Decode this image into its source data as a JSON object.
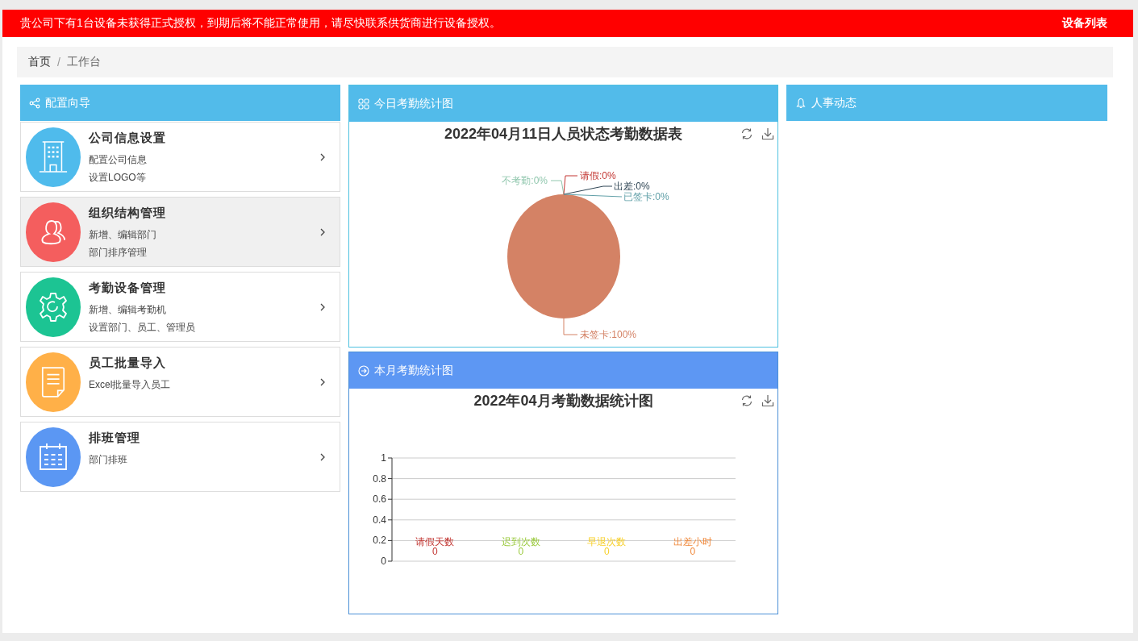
{
  "notice_bar": {
    "message": "贵公司下有1台设备未获得正式授权，到期后将不能正常使用，请尽快联系供货商进行设备授权。",
    "link": "设备列表"
  },
  "breadcrumb": {
    "separator": "/",
    "items": [
      {
        "label": "首页"
      },
      {
        "label": "工作台"
      }
    ]
  },
  "config_guide": {
    "title": "配置向导",
    "items": [
      {
        "kind": "building",
        "title": "公司信息设置",
        "lines": [
          "配置公司信息",
          "设置LOGO等"
        ],
        "color": "#4fbbec",
        "selected": false
      },
      {
        "kind": "people",
        "title": "组织结构管理",
        "lines": [
          "新增、编辑部门",
          "部门排序管理"
        ],
        "color": "#f45e5e",
        "selected": true
      },
      {
        "kind": "gear",
        "title": "考勤设备管理",
        "lines": [
          "新增、编辑考勤机",
          "设置部门、员工、管理员"
        ],
        "color": "#1cc493",
        "selected": false
      },
      {
        "kind": "document",
        "title": "员工批量导入",
        "lines": [
          "Excel批量导入员工"
        ],
        "color": "#ffb048",
        "selected": false
      },
      {
        "kind": "calendar",
        "title": "排班管理",
        "lines": [
          "部门排班"
        ],
        "color": "#5b97f3",
        "selected": false
      }
    ]
  },
  "today_panel": {
    "title": "今日考勤统计图",
    "chart_data": {
      "type": "pie",
      "title": "2022年04月11日人员状态考勤数据表",
      "categories": [
        "不考勤",
        "请假",
        "出差",
        "已签卡",
        "未签卡"
      ],
      "values": [
        0,
        0,
        0,
        0,
        100
      ],
      "value_labels": [
        ":0%",
        ":0%",
        ":0%",
        ":0%",
        ":100%"
      ],
      "colors": [
        "#91c7ae",
        "#c23531",
        "#2f4554",
        "#61a0a8",
        "#d48265"
      ]
    }
  },
  "month_panel": {
    "title": "本月考勤统计图",
    "chart_data": {
      "type": "bar",
      "title": "2022年04月考勤数据统计图",
      "categories": [
        "请假天数",
        "迟到次数",
        "早退次数",
        "出差小时"
      ],
      "values": [
        0,
        0,
        0,
        0
      ],
      "colors": [
        "#c23531",
        "#9bca3e",
        "#f7d02c",
        "#f0883a"
      ],
      "ylim": [
        0,
        1
      ],
      "yticks": [
        0,
        0.2,
        0.4,
        0.6,
        0.8,
        1
      ],
      "grid": true,
      "data_labels": true
    }
  },
  "hr_panel": {
    "title": "人事动态"
  }
}
